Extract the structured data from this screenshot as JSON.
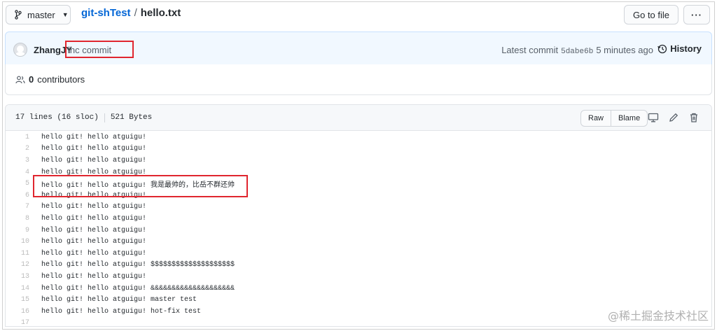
{
  "topbar": {
    "branch": "master",
    "repo": "git-shTest",
    "separator": "/",
    "file": "hello.txt",
    "goto_label": "Go to file",
    "more_label": "···"
  },
  "commit": {
    "author": "ZhangJY",
    "message": "lhc commit",
    "latest_label": "Latest commit",
    "sha": "5dabe6b",
    "time": "5 minutes ago",
    "history_label": "History"
  },
  "contributors": {
    "count": "0",
    "label": "contributors"
  },
  "file_header": {
    "lines": "17 lines (16 sloc)",
    "size": "521 Bytes",
    "raw_label": "Raw",
    "blame_label": "Blame"
  },
  "code_lines": [
    {
      "n": "1",
      "text": "hello git! hello atguigu!"
    },
    {
      "n": "2",
      "text": "hello git! hello atguigu!"
    },
    {
      "n": "3",
      "text": "hello git! hello atguigu!"
    },
    {
      "n": "4",
      "text": "hello git! hello atguigu!"
    },
    {
      "n": "5",
      "text": "hello git! hello atguigu! 我是最帅的，比岳不群还帅"
    },
    {
      "n": "6",
      "text": "hello git! hello atguigu!"
    },
    {
      "n": "7",
      "text": "hello git! hello atguigu!"
    },
    {
      "n": "8",
      "text": "hello git! hello atguigu!"
    },
    {
      "n": "9",
      "text": "hello git! hello atguigu!"
    },
    {
      "n": "10",
      "text": "hello git! hello atguigu!"
    },
    {
      "n": "11",
      "text": "hello git! hello atguigu!"
    },
    {
      "n": "12",
      "text": "hello git! hello atguigu! $$$$$$$$$$$$$$$$$$$$"
    },
    {
      "n": "13",
      "text": "hello git! hello atguigu!"
    },
    {
      "n": "14",
      "text": "hello git! hello atguigu! &&&&&&&&&&&&&&&&&&&&"
    },
    {
      "n": "15",
      "text": "hello git! hello atguigu! master test"
    },
    {
      "n": "16",
      "text": "hello git! hello atguigu! hot-fix test"
    },
    {
      "n": "17",
      "text": ""
    }
  ],
  "watermark": "@稀土掘金技术社区",
  "colors": {
    "link": "#0366d6",
    "highlight_box": "#e0262f",
    "commit_bg": "#f1f8ff"
  }
}
